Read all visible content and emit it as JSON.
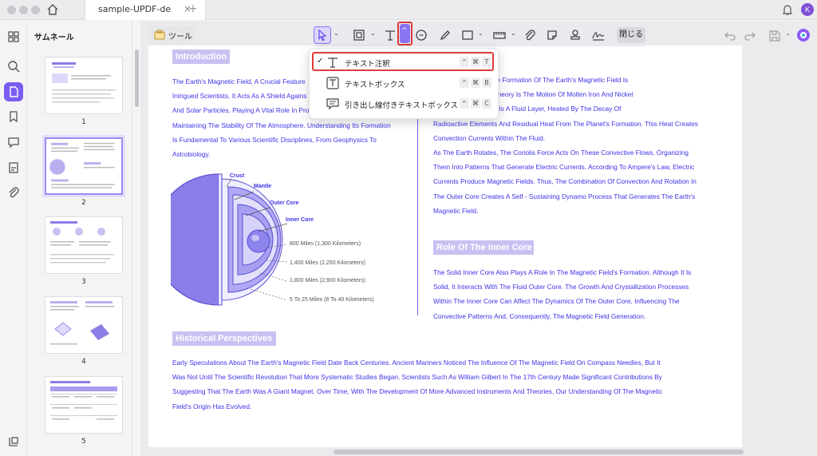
{
  "window": {
    "tab_title": "sample-UPDF-de",
    "tab_close": "×",
    "tab_add": "+",
    "avatar_initial": "K"
  },
  "sidebar": {
    "panel_title": "サムネール",
    "thumbnails": [
      {
        "page": "1"
      },
      {
        "page": "2",
        "selected": true
      },
      {
        "page": "3"
      },
      {
        "page": "4"
      },
      {
        "page": "5"
      }
    ]
  },
  "toolbar": {
    "tools_label": "ツール",
    "close_label": "閉じる"
  },
  "text_menu": {
    "items": [
      {
        "label": "テキスト注釈",
        "checked": true,
        "check": "✓",
        "keys": [
          "^",
          "⌘",
          "T"
        ],
        "icon": "text-icon"
      },
      {
        "label": "テキストボックス",
        "checked": false,
        "keys": [
          "^",
          "⌘",
          "B"
        ],
        "icon": "textbox-icon"
      },
      {
        "label": "引き出し線付きテキストボックス",
        "checked": false,
        "keys": [
          "^",
          "⌘",
          "C"
        ],
        "icon": "callout-icon"
      }
    ]
  },
  "document": {
    "intro_heading": "Introduction",
    "intro_lines": [
      "The Earth's Magnetic Field, A Crucial Feature",
      "Intrigued Scientists. It Acts As A Shield Agains",
      "And Solar Particles, Playing A Vital Role In Pro",
      "Maintaining The Stability Of The Atmosphere. Understanding Its Formation",
      "Is Fundamental To Various Scientific Disciplines, From Geophysics To",
      "Astrobiology."
    ],
    "diagram_labels": {
      "crust": "Crust",
      "mantle": "Mantle",
      "outer_core": "Outer Core",
      "inner_core": "Inner Core"
    },
    "diagram_measures": [
      "800 Miles (1,300 Kilometers)",
      "1,400 Miles (2,250 Kilometers)",
      "1,800 Miles (2,900 Kilometers)",
      "5 To 25 Miles (8 To 40 Kilometers)"
    ],
    "right_top_lines": [
      "cepted Theory For The Formation Of The Earth's Magnetic Field Is",
      "At The Core Of This Theory Is The Motion Of Molten Iron And Nickel",
      "Core. The Outer Core Is A Fluid Layer, Heated By The Decay Of",
      "Radioactive Elements And Residual Heat From The Planet's Formation. This Heat Creates",
      "Convection Currents Within The Fluid.",
      "As The Earth Rotates, The Coriolis Force Acts On These Convective Flows, Organizing",
      "Them Into Patterns That Generate Electric Currents. According To Ampere's Law, Electric",
      "Currents Produce Magnetic Fields. Thus, The Combination Of Convection And Rotation In",
      "The Outer Core Creates A Self - Sustaining Dynamo Process That Generates The Earth's",
      "Magnetic Field."
    ],
    "inner_core_heading": "Role Of The Inner Core",
    "inner_core_lines": [
      "The Solid Inner Core Also Plays A Role In The Magnetic Field's Formation. Although It Is",
      "Solid, It Interacts With The Fluid Outer Core. The Growth And Crystallization Processes",
      "Within The Inner Core Can Affect The Dynamics Of The Outer Core, Influencing The",
      "Convective Patterns And, Consequently, The Magnetic Field Generation."
    ],
    "historical_heading": "Historical Perspectives",
    "historical_lines": [
      "Early Speculations About The Earth's Magnetic Field Date Back Centuries. Ancient Mariners Noticed The Influence Of The Magnetic Field On Compass Needles, But It",
      "Was Not Until The Scientific Revolution That More Systematic Studies Began. Scientists Such As William Gilbert In The 17th Century Made Significant Contributions By",
      "Suggesting That The Earth Was A Giant Magnet. Over Time, With The Development Of More Advanced Instruments And Theories, Our Understanding Of The Magnetic",
      "Field's Origin Has Evolved."
    ]
  },
  "colors": {
    "accent": "#7a5cf0",
    "doc_text": "#3f33e6",
    "heading_bg": "#c8c2f2",
    "highlight": "#e03a3a"
  }
}
